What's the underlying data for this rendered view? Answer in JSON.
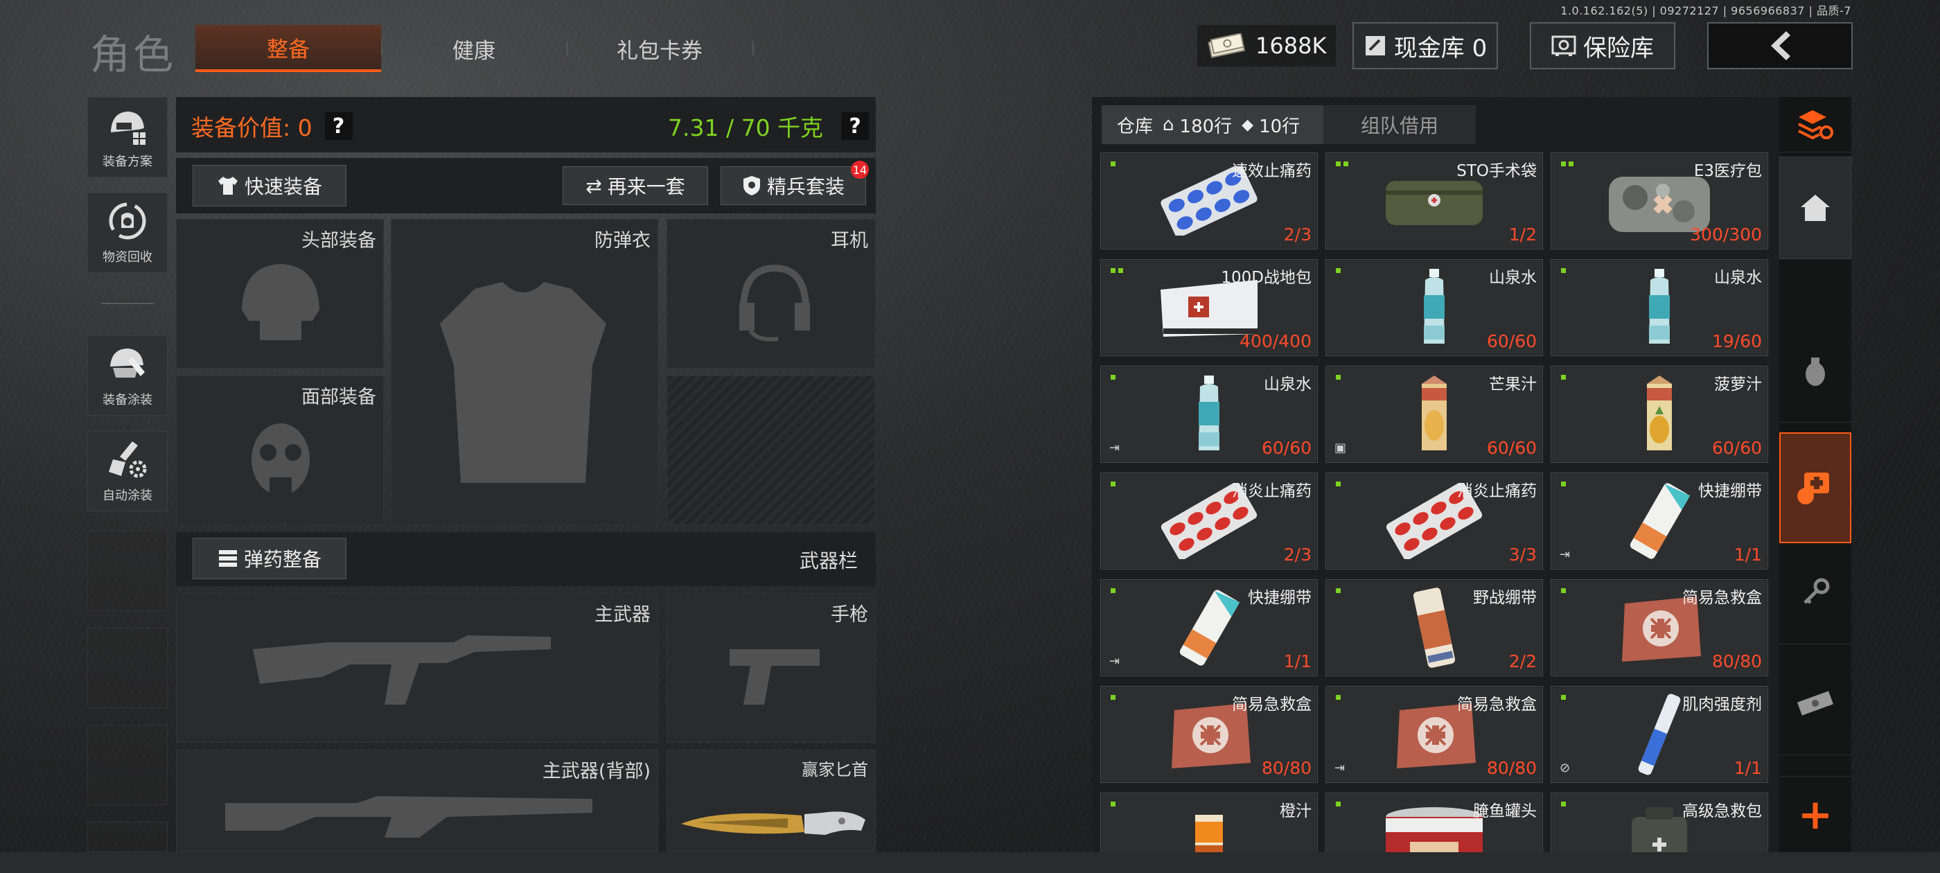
{
  "version": "1.0.162.162(5) | 09272127 | 9656966837 | 品质-7",
  "header": {
    "title": "角色",
    "tabs": [
      {
        "label": "整备",
        "active": true
      },
      {
        "label": "健康"
      },
      {
        "label": "礼包卡券"
      }
    ],
    "money": "1688K",
    "cash_vault": "现金库 0",
    "safe_box": "保险库"
  },
  "sidebar": {
    "items": [
      {
        "label": "装备方案",
        "icon": "gear-plan-icon"
      },
      {
        "label": "物资回收",
        "icon": "recycle-icon"
      },
      {
        "label": "装备涂装",
        "icon": "paint-icon"
      },
      {
        "label": "自动涂装",
        "icon": "auto-paint-icon"
      }
    ]
  },
  "loadout": {
    "value_label": "装备价值: 0",
    "weight": "7.31 / 70 千克",
    "quick_equip": "快速装备",
    "again_label": "再来一套",
    "elite_label": "精兵套装",
    "elite_badge": "14",
    "slots": {
      "head": "头部装备",
      "armor": "防弹衣",
      "ear": "耳机",
      "face": "面部装备",
      "ammo_button": "弹药整备",
      "weapon_bar": "武器栏",
      "primary": "主武器",
      "pistol": "手枪",
      "primary_back": "主武器(背部)",
      "knife": "赢家匕首"
    }
  },
  "warehouse": {
    "tab_label": "仓库",
    "rows_home": "180行",
    "rows_tag": "10行",
    "team_tab": "组队借用",
    "items": [
      {
        "name": "速效止痛药",
        "count": "2/3",
        "pic": "pills-blue",
        "dots": 1
      },
      {
        "name": "STO手术袋",
        "count": "1/2",
        "pic": "bag-green",
        "dots": 2
      },
      {
        "name": "E3医疗包",
        "count": "300/300",
        "pic": "bag-camo",
        "dots": 2
      },
      {
        "name": "100D战地包",
        "count": "400/400",
        "pic": "bag-white",
        "dots": 2
      },
      {
        "name": "山泉水",
        "count": "60/60",
        "pic": "bottle",
        "dots": 1
      },
      {
        "name": "山泉水",
        "count": "19/60",
        "pic": "bottle",
        "dots": 1
      },
      {
        "name": "山泉水",
        "count": "60/60",
        "pic": "bottle",
        "dots": 1,
        "corner": "⇥"
      },
      {
        "name": "芒果汁",
        "count": "60/60",
        "pic": "juice-mango",
        "dots": 1,
        "corner": "▣"
      },
      {
        "name": "菠萝汁",
        "count": "60/60",
        "pic": "juice-pine",
        "dots": 1
      },
      {
        "name": "消炎止痛药",
        "count": "2/3",
        "pic": "pills-red",
        "dots": 1
      },
      {
        "name": "消炎止痛药",
        "count": "3/3",
        "pic": "pills-red",
        "dots": 1
      },
      {
        "name": "快捷绷带",
        "count": "1/1",
        "pic": "bandage",
        "dots": 1,
        "corner": "⇥"
      },
      {
        "name": "快捷绷带",
        "count": "1/1",
        "pic": "bandage",
        "dots": 1,
        "corner": "⇥"
      },
      {
        "name": "野战绷带",
        "count": "2/2",
        "pic": "bandage2",
        "dots": 1
      },
      {
        "name": "简易急救盒",
        "count": "80/80",
        "pic": "medbox",
        "dots": 1
      },
      {
        "name": "简易急救盒",
        "count": "80/80",
        "pic": "medbox",
        "dots": 1
      },
      {
        "name": "简易急救盒",
        "count": "80/80",
        "pic": "medbox",
        "dots": 1,
        "corner": "⇥"
      },
      {
        "name": "肌肉强度剂",
        "count": "1/1",
        "pic": "injector",
        "dots": 1,
        "corner": "⊘"
      },
      {
        "name": "橙汁",
        "count": "",
        "pic": "juice-orange",
        "dots": 1
      },
      {
        "name": "腌鱼罐头",
        "count": "",
        "pic": "can",
        "dots": 1
      },
      {
        "name": "高级急救包",
        "count": "",
        "pic": "medkit",
        "dots": 1
      }
    ]
  },
  "colors": {
    "accent": "#ff6b21",
    "green": "#7ed321",
    "count_red": "#ff4b2b"
  }
}
